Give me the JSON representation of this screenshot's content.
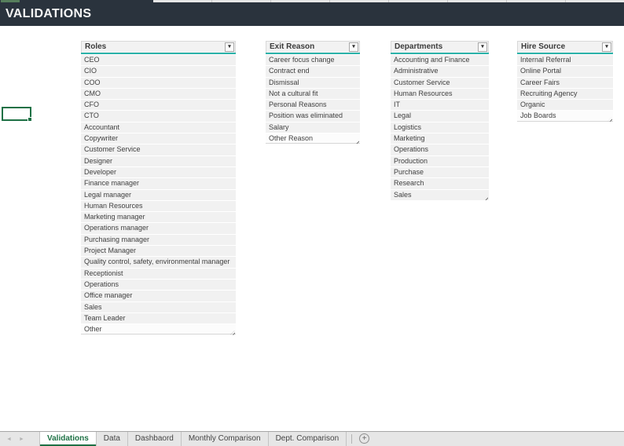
{
  "title": "VALIDATIONS",
  "icons": {
    "dropdown": "▾",
    "scroll_left": "◄",
    "scroll_right": "►",
    "add_sheet": "+"
  },
  "colors": {
    "title_bar": "#2a333d",
    "accent_teal": "#2bb2a9",
    "excel_green": "#1e7145",
    "row_fill": "#f1f1f1",
    "green_cell_fragment": "#567e5c"
  },
  "lists": [
    {
      "header": "Roles",
      "items": [
        "CEO",
        "CIO",
        "COO",
        "CMO",
        "CFO",
        "CTO",
        "Accountant",
        "Copywriter",
        "Customer Service",
        "Designer",
        "Developer",
        "Finance manager",
        "Legal manager",
        "Human Resources",
        "Marketing manager",
        "Operations manager",
        "Purchasing manager",
        "Project Manager",
        "Quality control, safety, environmental manager",
        "Receptionist",
        "Operations",
        "Office manager",
        "Sales",
        "Team Leader",
        "Other"
      ]
    },
    {
      "header": "Exit Reason",
      "items": [
        "Career focus change",
        "Contract end",
        "Dismissal",
        "Not a cultural fit",
        "Personal Reasons",
        "Position was eliminated",
        "Salary",
        "Other Reason"
      ]
    },
    {
      "header": "Departments",
      "items": [
        "Accounting and Finance",
        "Administrative",
        "Customer Service",
        "Human Resources",
        "IT",
        "Legal",
        "Logistics",
        "Marketing",
        "Operations",
        "Production",
        "Purchase",
        "Research",
        "Sales"
      ]
    },
    {
      "header": "Hire Source",
      "items": [
        "Internal Referral",
        "Online Portal",
        "Career Fairs",
        "Recruiting Agency",
        "Organic",
        "Job Boards"
      ]
    }
  ],
  "sheet_tabs": {
    "active": "Validations",
    "tabs": [
      "Validations",
      "Data",
      "Dashbaord",
      "Monthly Comparison",
      "Dept. Comparison"
    ]
  }
}
